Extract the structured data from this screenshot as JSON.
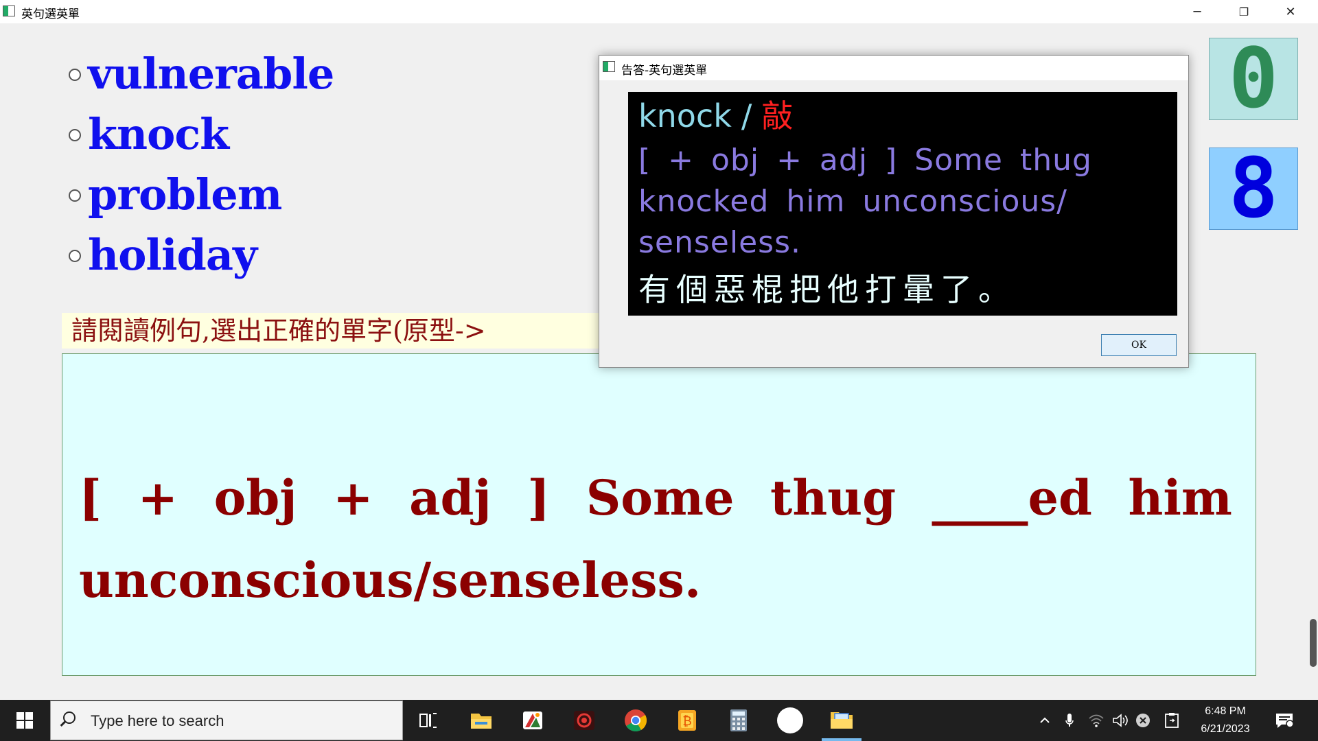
{
  "window": {
    "title": "英句選英單",
    "minimize": "─",
    "restore": "❐",
    "close": "✕"
  },
  "options": [
    {
      "label": "vulnerable"
    },
    {
      "label": "knock"
    },
    {
      "label": "problem"
    },
    {
      "label": "holiday"
    }
  ],
  "instruction": "請閱讀例句,選出正確的單字(原型->",
  "question": "[ + obj + adj ] Some thug ____ed him unconscious/senseless.",
  "score": {
    "top_digit": "0",
    "bottom_digit": "8",
    "top_color": "#2e8b57",
    "bottom_color": "#0000dd"
  },
  "dialog": {
    "title": "告答-英句選英單",
    "word": "knock",
    "slash": "/",
    "chinese": "敲",
    "sentence": "[ + obj + adj ] Some thug knocked him unconscious/ senseless.",
    "translation": "有個惡棍把他打暈了。",
    "ok_label": "OK"
  },
  "taskbar": {
    "search_placeholder": "Type here to search",
    "icons": [
      "task-view-icon",
      "file-explorer-icon",
      "office-app-icon",
      "screen-recorder-icon",
      "chrome-icon",
      "notes-app-icon",
      "calculator-icon",
      "circle-app-icon",
      "quiz-app-icon"
    ],
    "time": "6:48 PM",
    "date": "6/21/2023"
  }
}
